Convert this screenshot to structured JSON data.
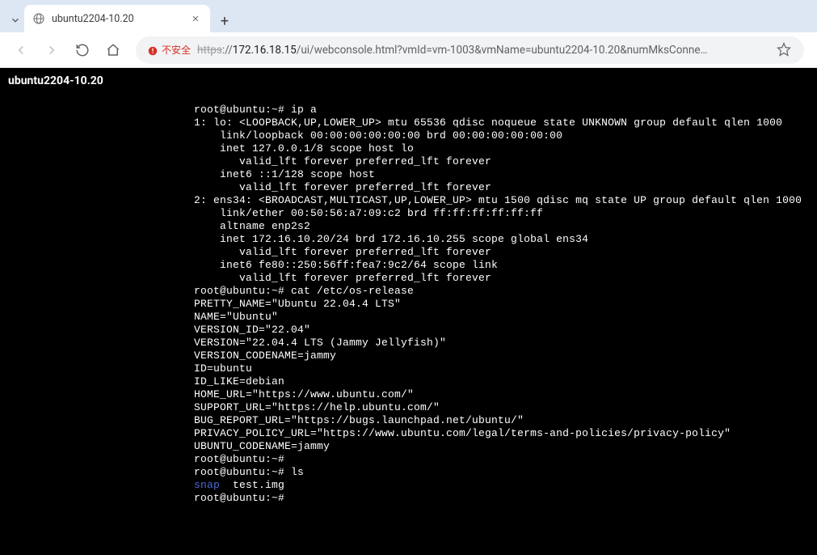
{
  "browser": {
    "tab_title": "ubuntu2204-10.20",
    "security_label": "不安全",
    "url_scheme": "https",
    "url_sep": "://",
    "url_host": "172.16.18.15",
    "url_path": "/ui/webconsole.html?vmId=vm-1003&vmName=ubuntu2204-10.20&numMksConne…"
  },
  "console": {
    "vm_name": "ubuntu2204-10.20",
    "lines": [
      "root@ubuntu:~# ip a",
      "1: lo: <LOOPBACK,UP,LOWER_UP> mtu 65536 qdisc noqueue state UNKNOWN group default qlen 1000",
      "    link/loopback 00:00:00:00:00:00 brd 00:00:00:00:00:00",
      "    inet 127.0.0.1/8 scope host lo",
      "       valid_lft forever preferred_lft forever",
      "    inet6 ::1/128 scope host",
      "       valid_lft forever preferred_lft forever",
      "2: ens34: <BROADCAST,MULTICAST,UP,LOWER_UP> mtu 1500 qdisc mq state UP group default qlen 1000",
      "    link/ether 00:50:56:a7:09:c2 brd ff:ff:ff:ff:ff:ff",
      "    altname enp2s2",
      "    inet 172.16.10.20/24 brd 172.16.10.255 scope global ens34",
      "       valid_lft forever preferred_lft forever",
      "    inet6 fe80::250:56ff:fea7:9c2/64 scope link",
      "       valid_lft forever preferred_lft forever",
      "root@ubuntu:~# cat /etc/os-release",
      "PRETTY_NAME=\"Ubuntu 22.04.4 LTS\"",
      "NAME=\"Ubuntu\"",
      "VERSION_ID=\"22.04\"",
      "VERSION=\"22.04.4 LTS (Jammy Jellyfish)\"",
      "VERSION_CODENAME=jammy",
      "ID=ubuntu",
      "ID_LIKE=debian",
      "HOME_URL=\"https://www.ubuntu.com/\"",
      "SUPPORT_URL=\"https://help.ubuntu.com/\"",
      "BUG_REPORT_URL=\"https://bugs.launchpad.net/ubuntu/\"",
      "PRIVACY_POLICY_URL=\"https://www.ubuntu.com/legal/terms-and-policies/privacy-policy\"",
      "UBUNTU_CODENAME=jammy",
      "root@ubuntu:~#",
      "root@ubuntu:~# ls"
    ],
    "ls_output": {
      "dir": "snap",
      "rest": "  test.img"
    },
    "final_prompt": "root@ubuntu:~#"
  }
}
